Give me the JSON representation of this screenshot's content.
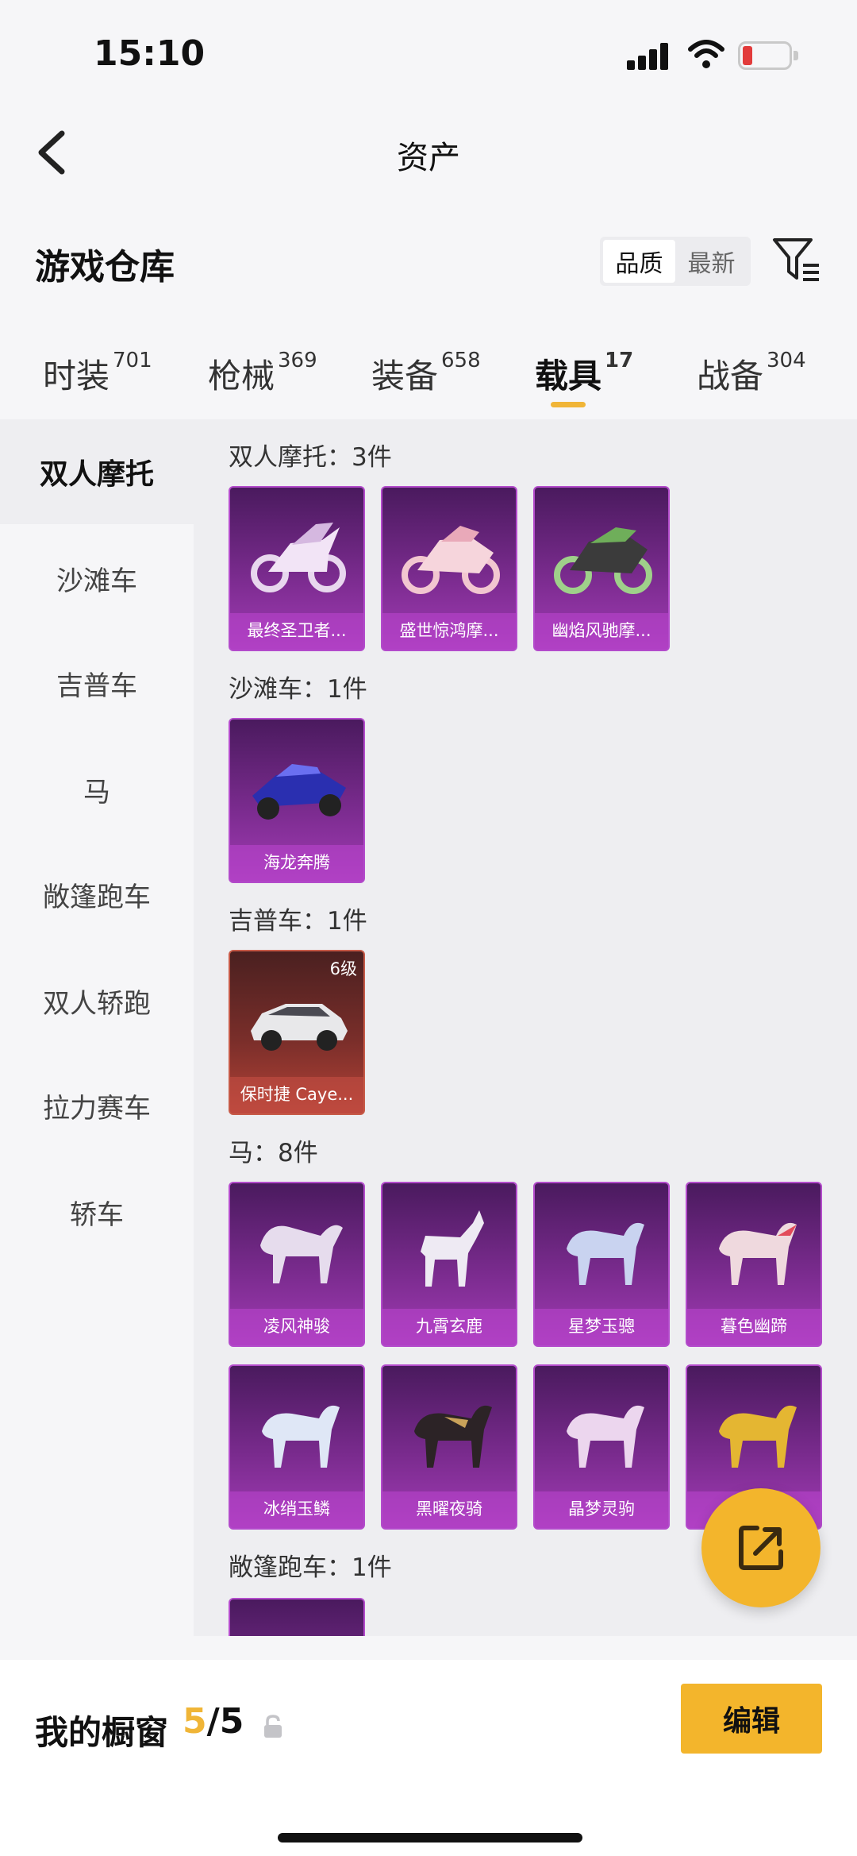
{
  "status_bar": {
    "time": "15:10"
  },
  "header": {
    "title": "资产"
  },
  "section": {
    "title": "游戏仓库",
    "sort_options": [
      "品质",
      "最新"
    ],
    "sort_selected": "品质"
  },
  "tabs": [
    {
      "label": "时装",
      "count": "701"
    },
    {
      "label": "枪械",
      "count": "369"
    },
    {
      "label": "装备",
      "count": "658"
    },
    {
      "label": "载具",
      "count": "17",
      "active": true
    },
    {
      "label": "战备",
      "count": "304"
    }
  ],
  "sidebar": {
    "items": [
      "双人摩托",
      "沙滩车",
      "吉普车",
      "马",
      "敞篷跑车",
      "双人轿跑",
      "拉力赛车",
      "轿车"
    ],
    "active": "双人摩托"
  },
  "groups": [
    {
      "label": "双人摩托：3件",
      "items": [
        {
          "name": "最终圣卫者...",
          "icon": "motorcycle-icon"
        },
        {
          "name": "盛世惊鸿摩...",
          "icon": "motorcycle-icon"
        },
        {
          "name": "幽焰风驰摩...",
          "icon": "motorcycle-icon"
        }
      ]
    },
    {
      "label": "沙滩车：1件",
      "items": [
        {
          "name": "海龙奔腾",
          "icon": "atv-icon"
        }
      ]
    },
    {
      "label": "吉普车：1件",
      "items": [
        {
          "name": "保时捷 Caye...",
          "level": "6级",
          "icon": "suv-icon"
        }
      ]
    },
    {
      "label": "马：8件",
      "items": [
        {
          "name": "凌风神骏",
          "icon": "horse-icon"
        },
        {
          "name": "九霄玄鹿",
          "icon": "deer-icon"
        },
        {
          "name": "星梦玉骢",
          "icon": "horse-icon"
        },
        {
          "name": "暮色幽蹄",
          "icon": "horse-icon"
        },
        {
          "name": "冰绡玉鳞",
          "icon": "horse-icon"
        },
        {
          "name": "黑曜夜骑",
          "icon": "horse-icon"
        },
        {
          "name": "晶梦灵驹",
          "icon": "horse-icon"
        },
        {
          "name": "",
          "icon": "horse-icon"
        }
      ]
    },
    {
      "label": "敞篷跑车：1件",
      "items": [
        {
          "name": "",
          "icon": "car-icon"
        }
      ]
    }
  ],
  "bottom_bar": {
    "label": "我的橱窗",
    "count_current": "5",
    "count_total": "/5",
    "edit_label": "编辑"
  },
  "colors": {
    "accent": "#f3b52c",
    "card_purple": "#8b2fa3",
    "card_red": "#9a3a30"
  }
}
